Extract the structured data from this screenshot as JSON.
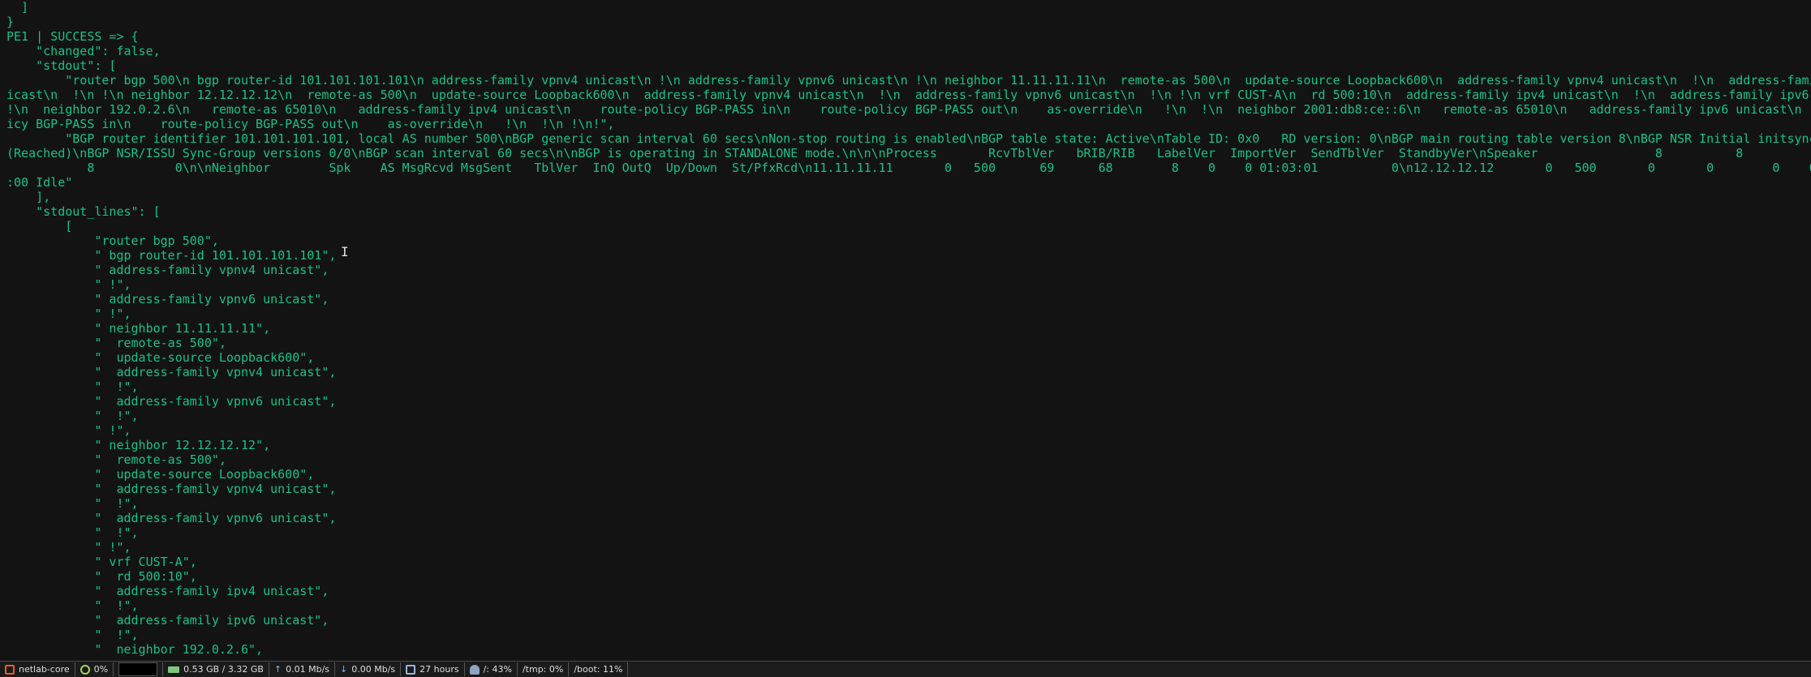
{
  "terminal": {
    "lines": [
      "  ]",
      "}",
      "PE1 | SUCCESS => {",
      "    \"changed\": false,",
      "    \"stdout\": [",
      "        \"router bgp 500\\n bgp router-id 101.101.101.101\\n address-family vpnv4 unicast\\n !\\n address-family vpnv6 unicast\\n !\\n neighbor 11.11.11.11\\n  remote-as 500\\n  update-source Loopback600\\n  address-family vpnv4 unicast\\n  !\\n  address-famil",
      "icast\\n  !\\n !\\n neighbor 12.12.12.12\\n  remote-as 500\\n  update-source Loopback600\\n  address-family vpnv4 unicast\\n  !\\n  address-family vpnv6 unicast\\n  !\\n !\\n vrf CUST-A\\n  rd 500:10\\n  address-family ipv4 unicast\\n  !\\n  address-family ipv6 u",
      "!\\n  neighbor 192.0.2.6\\n   remote-as 65010\\n   address-family ipv4 unicast\\n    route-policy BGP-PASS in\\n    route-policy BGP-PASS out\\n    as-override\\n   !\\n  !\\n  neighbor 2001:db8:ce::6\\n   remote-as 65010\\n   address-family ipv6 unicast\\n",
      "icy BGP-PASS in\\n    route-policy BGP-PASS out\\n    as-override\\n   !\\n  !\\n !\\n!\",",
      "        \"BGP router identifier 101.101.101.101, local AS number 500\\nBGP generic scan interval 60 secs\\nNon-stop routing is enabled\\nBGP table state: Active\\nTable ID: 0x0   RD version: 0\\nBGP main routing table version 8\\nBGP NSR Initial initsync",
      "(Reached)\\nBGP NSR/ISSU Sync-Group versions 0/0\\nBGP scan interval 60 secs\\n\\nBGP is operating in STANDALONE mode.\\n\\n\\nProcess       RcvTblVer   bRIB/RIB   LabelVer  ImportVer  SendTblVer  StandbyVer\\nSpeaker                8          8          8",
      "           8           0\\n\\nNeighbor        Spk    AS MsgRcvd MsgSent   TblVer  InQ OutQ  Up/Down  St/PfxRcd\\n11.11.11.11       0   500      69      68        8    0    0 01:03:01          0\\n12.12.12.12       0   500       0       0        0    0",
      ":00 Idle\"",
      "    ],",
      "    \"stdout_lines\": [",
      "        [",
      "            \"router bgp 500\",",
      "            \" bgp router-id 101.101.101.101\",",
      "            \" address-family vpnv4 unicast\",",
      "            \" !\",",
      "            \" address-family vpnv6 unicast\",",
      "            \" !\",",
      "            \" neighbor 11.11.11.11\",",
      "            \"  remote-as 500\",",
      "            \"  update-source Loopback600\",",
      "            \"  address-family vpnv4 unicast\",",
      "            \"  !\",",
      "            \"  address-family vpnv6 unicast\",",
      "            \"  !\",",
      "            \" !\",",
      "            \" neighbor 12.12.12.12\",",
      "            \"  remote-as 500\",",
      "            \"  update-source Loopback600\",",
      "            \"  address-family vpnv4 unicast\",",
      "            \"  !\",",
      "            \"  address-family vpnv6 unicast\",",
      "            \"  !\",",
      "            \" !\",",
      "            \" vrf CUST-A\",",
      "            \"  rd 500:10\",",
      "            \"  address-family ipv4 unicast\",",
      "            \"  !\",",
      "            \"  address-family ipv6 unicast\",",
      "            \"  !\",",
      "            \"  neighbor 192.0.2.6\","
    ],
    "cursor_glyph": "I",
    "text_color": "#16c28a",
    "background": "#131313"
  },
  "statusbar": {
    "hostname": "netlab-core",
    "cpu": "0%",
    "memory": "0.53 GB / 3.32 GB",
    "net_up": "0.01 Mb/s",
    "net_down": "0.00 Mb/s",
    "uptime": "27 hours",
    "disk_root": "/: 43%",
    "disk_tmp": "/tmp: 0%",
    "disk_boot": "/boot: 11%",
    "icons": [
      "host-icon",
      "cpu-icon",
      "memory-icon",
      "upload-icon",
      "download-icon",
      "clock-icon",
      "disk-icon"
    ],
    "up_arrow": "↑",
    "down_arrow": "↓"
  }
}
